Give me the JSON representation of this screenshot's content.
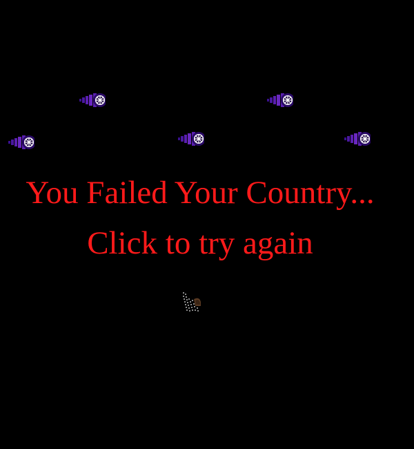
{
  "game_over": {
    "line1": "You Failed Your Country...",
    "line2": "Click to try again"
  },
  "colors": {
    "background": "#000000",
    "message": "#ff1a1a",
    "enemy_body": "#5a1fb0",
    "enemy_dark": "#2a0a66",
    "enemy_wheel": "#ffffff",
    "player": "#8c8c8c"
  },
  "sprites": {
    "enemy_icon": "purple-drill-ship-icon",
    "player_icon": "wrecked-tank-icon"
  }
}
